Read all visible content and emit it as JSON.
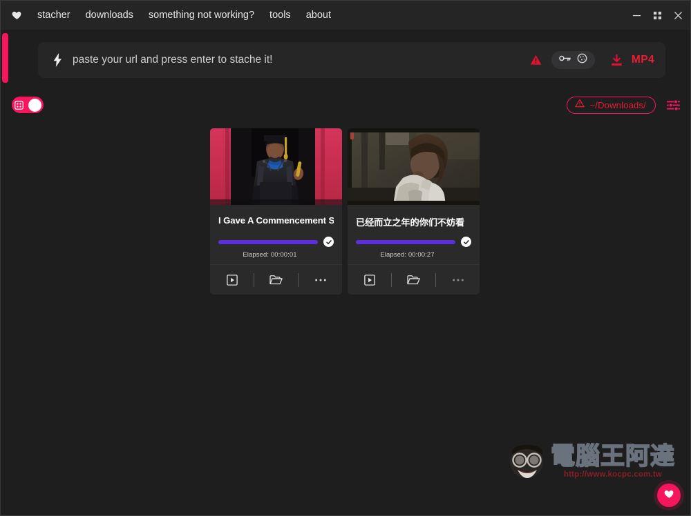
{
  "window": {
    "app_icon": "heart-icon",
    "controls": {
      "minimize": "minimize-icon",
      "maximize": "maximize-icon",
      "close": "close-icon"
    }
  },
  "menu": {
    "items": [
      {
        "label": "stacher"
      },
      {
        "label": "downloads"
      },
      {
        "label": "something not working?"
      },
      {
        "label": "tools"
      },
      {
        "label": "about"
      }
    ]
  },
  "urlbar": {
    "icon": "lightning-bolt-icon",
    "value": "",
    "placeholder": "paste your url and press enter to stache it!",
    "warning_icon": "warning-triangle-icon",
    "key_icon": "key-icon",
    "cookie_icon": "cookie-icon",
    "download_icon": "download-icon",
    "format_label": "MP4"
  },
  "toolbar": {
    "view_toggle": {
      "icon": "grid-view-icon",
      "state": "on"
    },
    "path_button": {
      "icon": "warning-triangle-icon",
      "label": "~/Downloads/"
    },
    "settings_icon": "sliders-icon"
  },
  "cards": [
    {
      "title": "I Gave A Commencement S",
      "elapsed": "Elapsed: 00:00:01",
      "progress": 100,
      "status": "complete",
      "thumbnail": "graduation-speech-thumbnail",
      "actions": {
        "play": "play-icon",
        "folder": "open-folder-icon",
        "more": "more-options-icon"
      }
    },
    {
      "title": "已经而立之年的你们不妨看",
      "elapsed": "Elapsed: 00:00:27",
      "progress": 100,
      "status": "complete",
      "thumbnail": "film-scene-thumbnail",
      "actions": {
        "play": "play-icon",
        "folder": "open-folder-icon",
        "more": "more-options-icon"
      }
    }
  ],
  "watermark": {
    "brand": "電腦王阿達",
    "url": "http://www.kocpc.com.tw"
  },
  "fab": {
    "icon": "heart-icon"
  },
  "colors": {
    "accent_pink": "#f5165e",
    "accent_red": "#ef1a35",
    "progress_purple": "#5b2fd9",
    "background": "#1e1e1e",
    "card_background": "#2a2a2a"
  }
}
